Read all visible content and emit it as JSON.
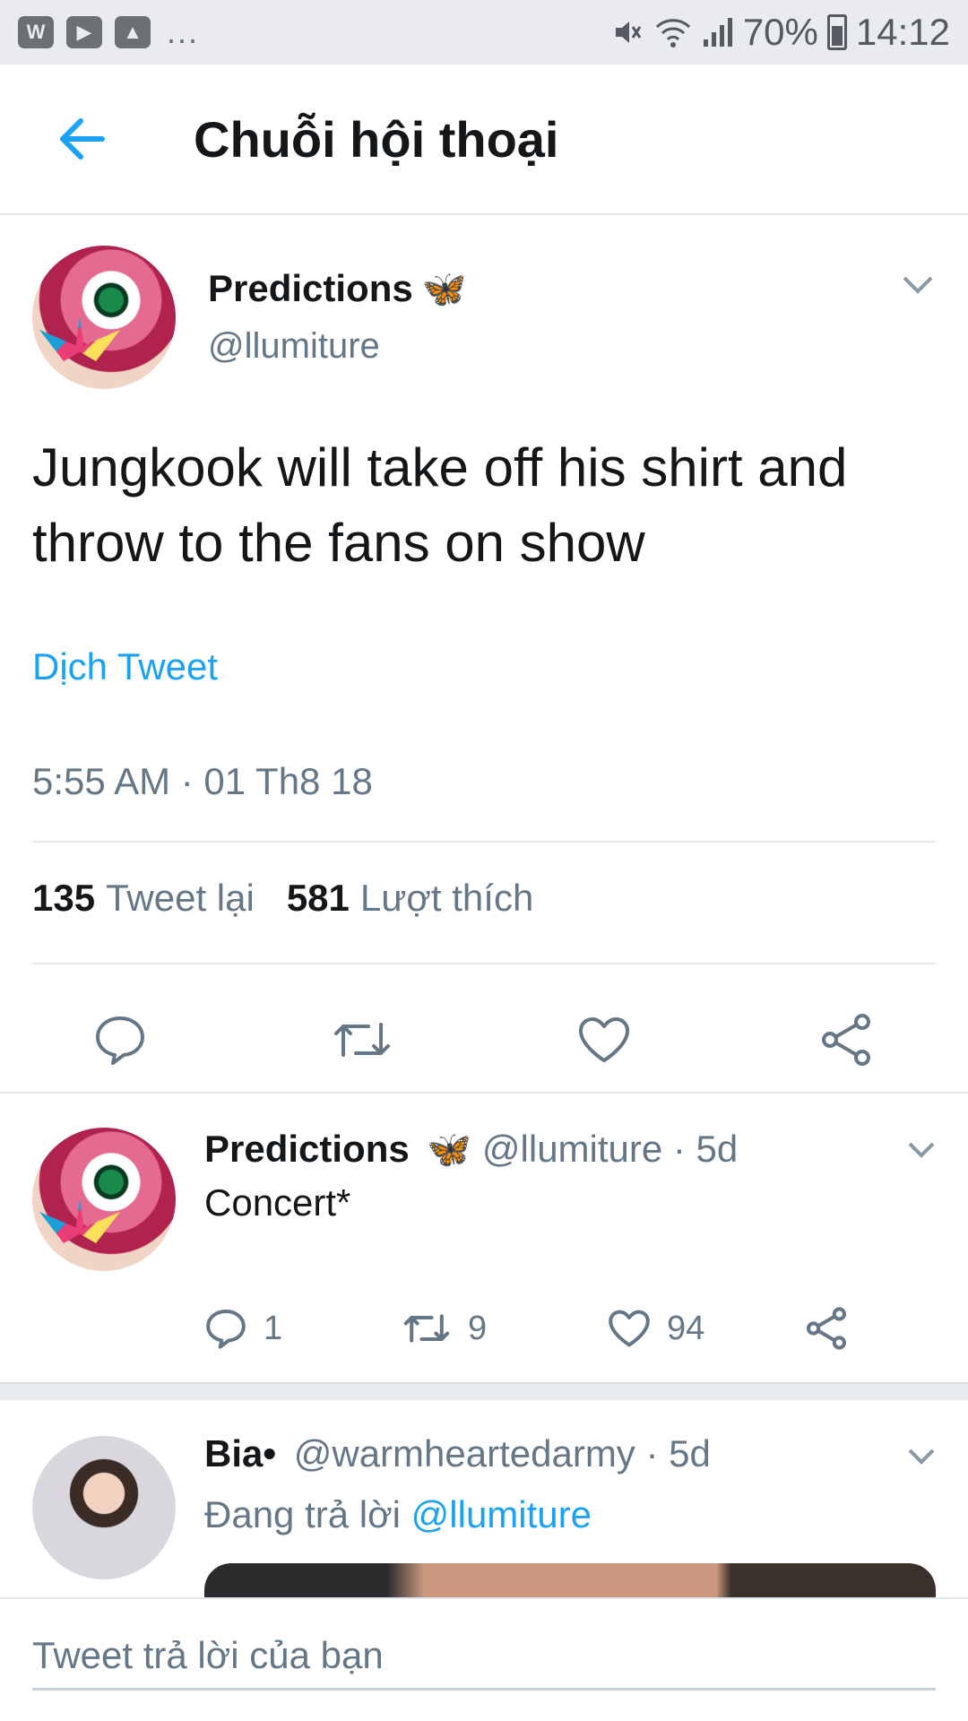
{
  "status_bar": {
    "left_icons": [
      "app-w-icon",
      "youtube-icon",
      "gallery-icon"
    ],
    "more": "...",
    "battery": "70%",
    "time": "14:12"
  },
  "header": {
    "title": "Chuỗi hội thoại"
  },
  "main_tweet": {
    "name": "Predictions",
    "emoji": "🦋",
    "handle": "@llumiture",
    "text": "Jungkook will take off his shirt and throw to the fans on show",
    "translate": "Dịch Tweet",
    "timestamp": "5:55 AM · 01 Th8 18",
    "retweets_count": "135",
    "retweets_label": "Tweet lại",
    "likes_count": "581",
    "likes_label": "Lượt thích"
  },
  "reply_1": {
    "name": "Predictions",
    "emoji": "🦋",
    "handle_time": "@llumiture · 5d",
    "text": "Concert*",
    "replies": "1",
    "retweets": "9",
    "likes": "94"
  },
  "reply_2": {
    "name": "Bia•",
    "handle_time": "@warmheartedarmy · 5d",
    "replying_prefix": "Đang trả lời",
    "replying_to": "@llumiture"
  },
  "compose": {
    "placeholder": "Tweet trả lời của bạn"
  },
  "colors": {
    "accent": "#1da1f2",
    "secondary_text": "#657786",
    "divider": "#e1e8ed"
  }
}
